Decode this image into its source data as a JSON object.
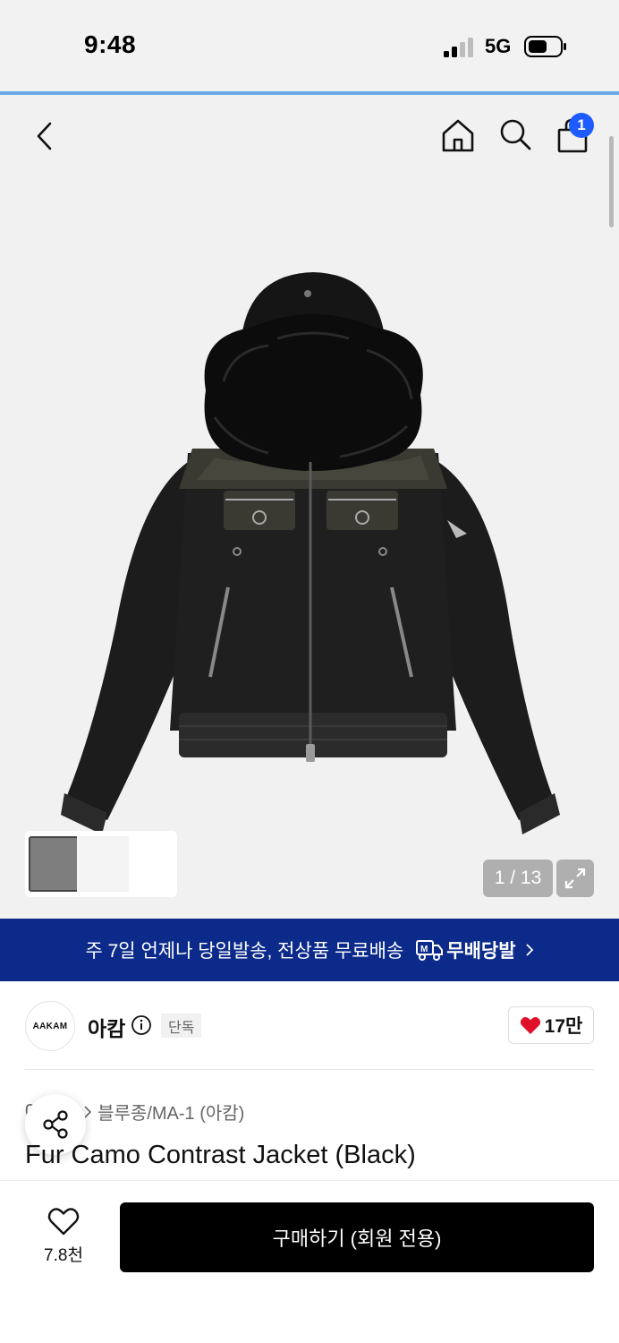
{
  "status_bar": {
    "time": "9:48",
    "network": "5G"
  },
  "header": {
    "cart_count": "1",
    "icons": [
      "back-icon",
      "home-icon",
      "search-icon",
      "shopping-bag-icon"
    ]
  },
  "gallery": {
    "counter": "1 / 13",
    "image": "black-fur-hood-camo-jacket"
  },
  "banner": {
    "text": "주 7일 언제나 당일발송, 전상품 무료배송",
    "brand": "무배당발"
  },
  "brand": {
    "logo_text": "AAKAM",
    "name": "아캄",
    "badge": "단독",
    "likes": "17만"
  },
  "breadcrumb": {
    "category_partial": "0",
    "subcategory": "블루종/MA-1 (아캄)"
  },
  "product": {
    "title": "Fur Camo Contrast Jacket (Black)"
  },
  "bottom_bar": {
    "wish_count": "7.8천",
    "buy_label": "구매하기 (회원 전용)"
  },
  "colors": {
    "banner_bg": "#0b2a8a",
    "badge_blue": "#1e5cff",
    "heart_red": "#e0102b",
    "buy_button": "#000000"
  }
}
